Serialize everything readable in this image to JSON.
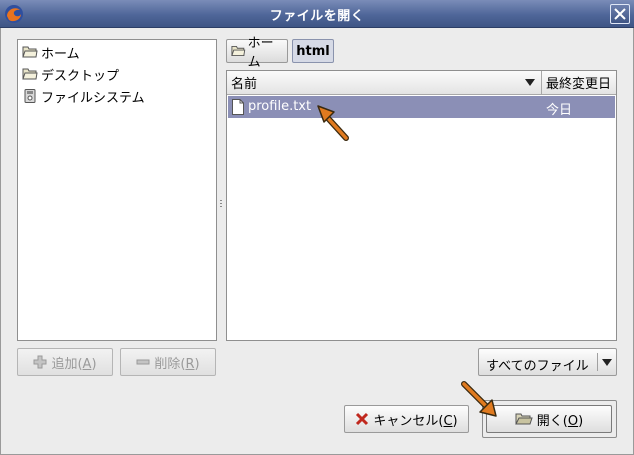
{
  "window": {
    "title": "ファイルを開く"
  },
  "places": {
    "items": [
      {
        "label": "ホーム",
        "icon": "folder-icon"
      },
      {
        "label": "デスクトップ",
        "icon": "folder-icon"
      },
      {
        "label": "ファイルシステム",
        "icon": "drive-icon"
      }
    ]
  },
  "path_bar": {
    "buttons": [
      {
        "label": "ホーム",
        "icon": "folder-icon"
      },
      {
        "label": "html",
        "active": true
      }
    ]
  },
  "file_list": {
    "columns": {
      "name": "名前",
      "modified": "最終変更日"
    },
    "rows": [
      {
        "name": "profile.txt",
        "modified": "今日",
        "selected": true,
        "icon": "text-file-icon"
      }
    ]
  },
  "places_actions": {
    "add_label": "追加(",
    "add_mnemonic": "A",
    "add_close": ")",
    "remove_label": "削除(",
    "remove_mnemonic": "R",
    "remove_close": ")"
  },
  "filter": {
    "selected": "すべてのファイル"
  },
  "dialog_buttons": {
    "cancel_label": "キャンセル(",
    "cancel_mnemonic": "C",
    "cancel_close": ")",
    "open_label": "開く(",
    "open_mnemonic": "O",
    "open_close": ")"
  },
  "colors": {
    "titlebar": "#4f6699",
    "selection": "#8b8fb6",
    "pointer": "#e07a1f"
  }
}
